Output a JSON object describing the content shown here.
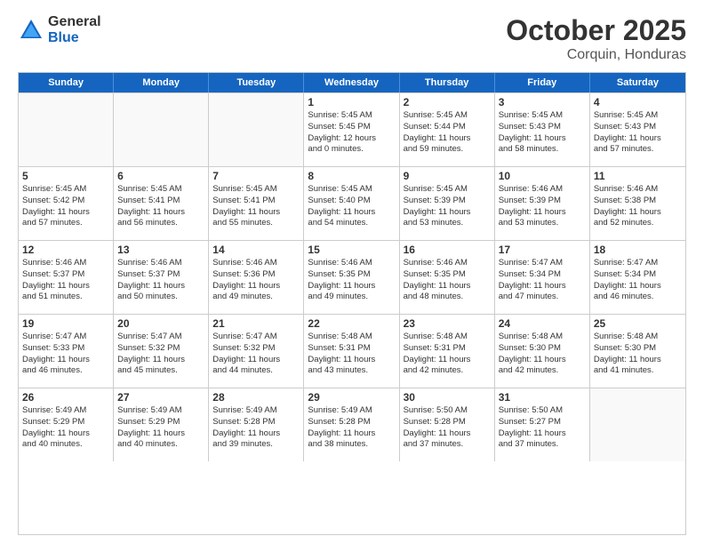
{
  "logo": {
    "general": "General",
    "blue": "Blue"
  },
  "header": {
    "month": "October 2025",
    "location": "Corquin, Honduras"
  },
  "days": [
    "Sunday",
    "Monday",
    "Tuesday",
    "Wednesday",
    "Thursday",
    "Friday",
    "Saturday"
  ],
  "weeks": [
    [
      {
        "day": "",
        "info": ""
      },
      {
        "day": "",
        "info": ""
      },
      {
        "day": "",
        "info": ""
      },
      {
        "day": "1",
        "info": "Sunrise: 5:45 AM\nSunset: 5:45 PM\nDaylight: 12 hours\nand 0 minutes."
      },
      {
        "day": "2",
        "info": "Sunrise: 5:45 AM\nSunset: 5:44 PM\nDaylight: 11 hours\nand 59 minutes."
      },
      {
        "day": "3",
        "info": "Sunrise: 5:45 AM\nSunset: 5:43 PM\nDaylight: 11 hours\nand 58 minutes."
      },
      {
        "day": "4",
        "info": "Sunrise: 5:45 AM\nSunset: 5:43 PM\nDaylight: 11 hours\nand 57 minutes."
      }
    ],
    [
      {
        "day": "5",
        "info": "Sunrise: 5:45 AM\nSunset: 5:42 PM\nDaylight: 11 hours\nand 57 minutes."
      },
      {
        "day": "6",
        "info": "Sunrise: 5:45 AM\nSunset: 5:41 PM\nDaylight: 11 hours\nand 56 minutes."
      },
      {
        "day": "7",
        "info": "Sunrise: 5:45 AM\nSunset: 5:41 PM\nDaylight: 11 hours\nand 55 minutes."
      },
      {
        "day": "8",
        "info": "Sunrise: 5:45 AM\nSunset: 5:40 PM\nDaylight: 11 hours\nand 54 minutes."
      },
      {
        "day": "9",
        "info": "Sunrise: 5:45 AM\nSunset: 5:39 PM\nDaylight: 11 hours\nand 53 minutes."
      },
      {
        "day": "10",
        "info": "Sunrise: 5:46 AM\nSunset: 5:39 PM\nDaylight: 11 hours\nand 53 minutes."
      },
      {
        "day": "11",
        "info": "Sunrise: 5:46 AM\nSunset: 5:38 PM\nDaylight: 11 hours\nand 52 minutes."
      }
    ],
    [
      {
        "day": "12",
        "info": "Sunrise: 5:46 AM\nSunset: 5:37 PM\nDaylight: 11 hours\nand 51 minutes."
      },
      {
        "day": "13",
        "info": "Sunrise: 5:46 AM\nSunset: 5:37 PM\nDaylight: 11 hours\nand 50 minutes."
      },
      {
        "day": "14",
        "info": "Sunrise: 5:46 AM\nSunset: 5:36 PM\nDaylight: 11 hours\nand 49 minutes."
      },
      {
        "day": "15",
        "info": "Sunrise: 5:46 AM\nSunset: 5:35 PM\nDaylight: 11 hours\nand 49 minutes."
      },
      {
        "day": "16",
        "info": "Sunrise: 5:46 AM\nSunset: 5:35 PM\nDaylight: 11 hours\nand 48 minutes."
      },
      {
        "day": "17",
        "info": "Sunrise: 5:47 AM\nSunset: 5:34 PM\nDaylight: 11 hours\nand 47 minutes."
      },
      {
        "day": "18",
        "info": "Sunrise: 5:47 AM\nSunset: 5:34 PM\nDaylight: 11 hours\nand 46 minutes."
      }
    ],
    [
      {
        "day": "19",
        "info": "Sunrise: 5:47 AM\nSunset: 5:33 PM\nDaylight: 11 hours\nand 46 minutes."
      },
      {
        "day": "20",
        "info": "Sunrise: 5:47 AM\nSunset: 5:32 PM\nDaylight: 11 hours\nand 45 minutes."
      },
      {
        "day": "21",
        "info": "Sunrise: 5:47 AM\nSunset: 5:32 PM\nDaylight: 11 hours\nand 44 minutes."
      },
      {
        "day": "22",
        "info": "Sunrise: 5:48 AM\nSunset: 5:31 PM\nDaylight: 11 hours\nand 43 minutes."
      },
      {
        "day": "23",
        "info": "Sunrise: 5:48 AM\nSunset: 5:31 PM\nDaylight: 11 hours\nand 42 minutes."
      },
      {
        "day": "24",
        "info": "Sunrise: 5:48 AM\nSunset: 5:30 PM\nDaylight: 11 hours\nand 42 minutes."
      },
      {
        "day": "25",
        "info": "Sunrise: 5:48 AM\nSunset: 5:30 PM\nDaylight: 11 hours\nand 41 minutes."
      }
    ],
    [
      {
        "day": "26",
        "info": "Sunrise: 5:49 AM\nSunset: 5:29 PM\nDaylight: 11 hours\nand 40 minutes."
      },
      {
        "day": "27",
        "info": "Sunrise: 5:49 AM\nSunset: 5:29 PM\nDaylight: 11 hours\nand 40 minutes."
      },
      {
        "day": "28",
        "info": "Sunrise: 5:49 AM\nSunset: 5:28 PM\nDaylight: 11 hours\nand 39 minutes."
      },
      {
        "day": "29",
        "info": "Sunrise: 5:49 AM\nSunset: 5:28 PM\nDaylight: 11 hours\nand 38 minutes."
      },
      {
        "day": "30",
        "info": "Sunrise: 5:50 AM\nSunset: 5:28 PM\nDaylight: 11 hours\nand 37 minutes."
      },
      {
        "day": "31",
        "info": "Sunrise: 5:50 AM\nSunset: 5:27 PM\nDaylight: 11 hours\nand 37 minutes."
      },
      {
        "day": "",
        "info": ""
      }
    ]
  ]
}
